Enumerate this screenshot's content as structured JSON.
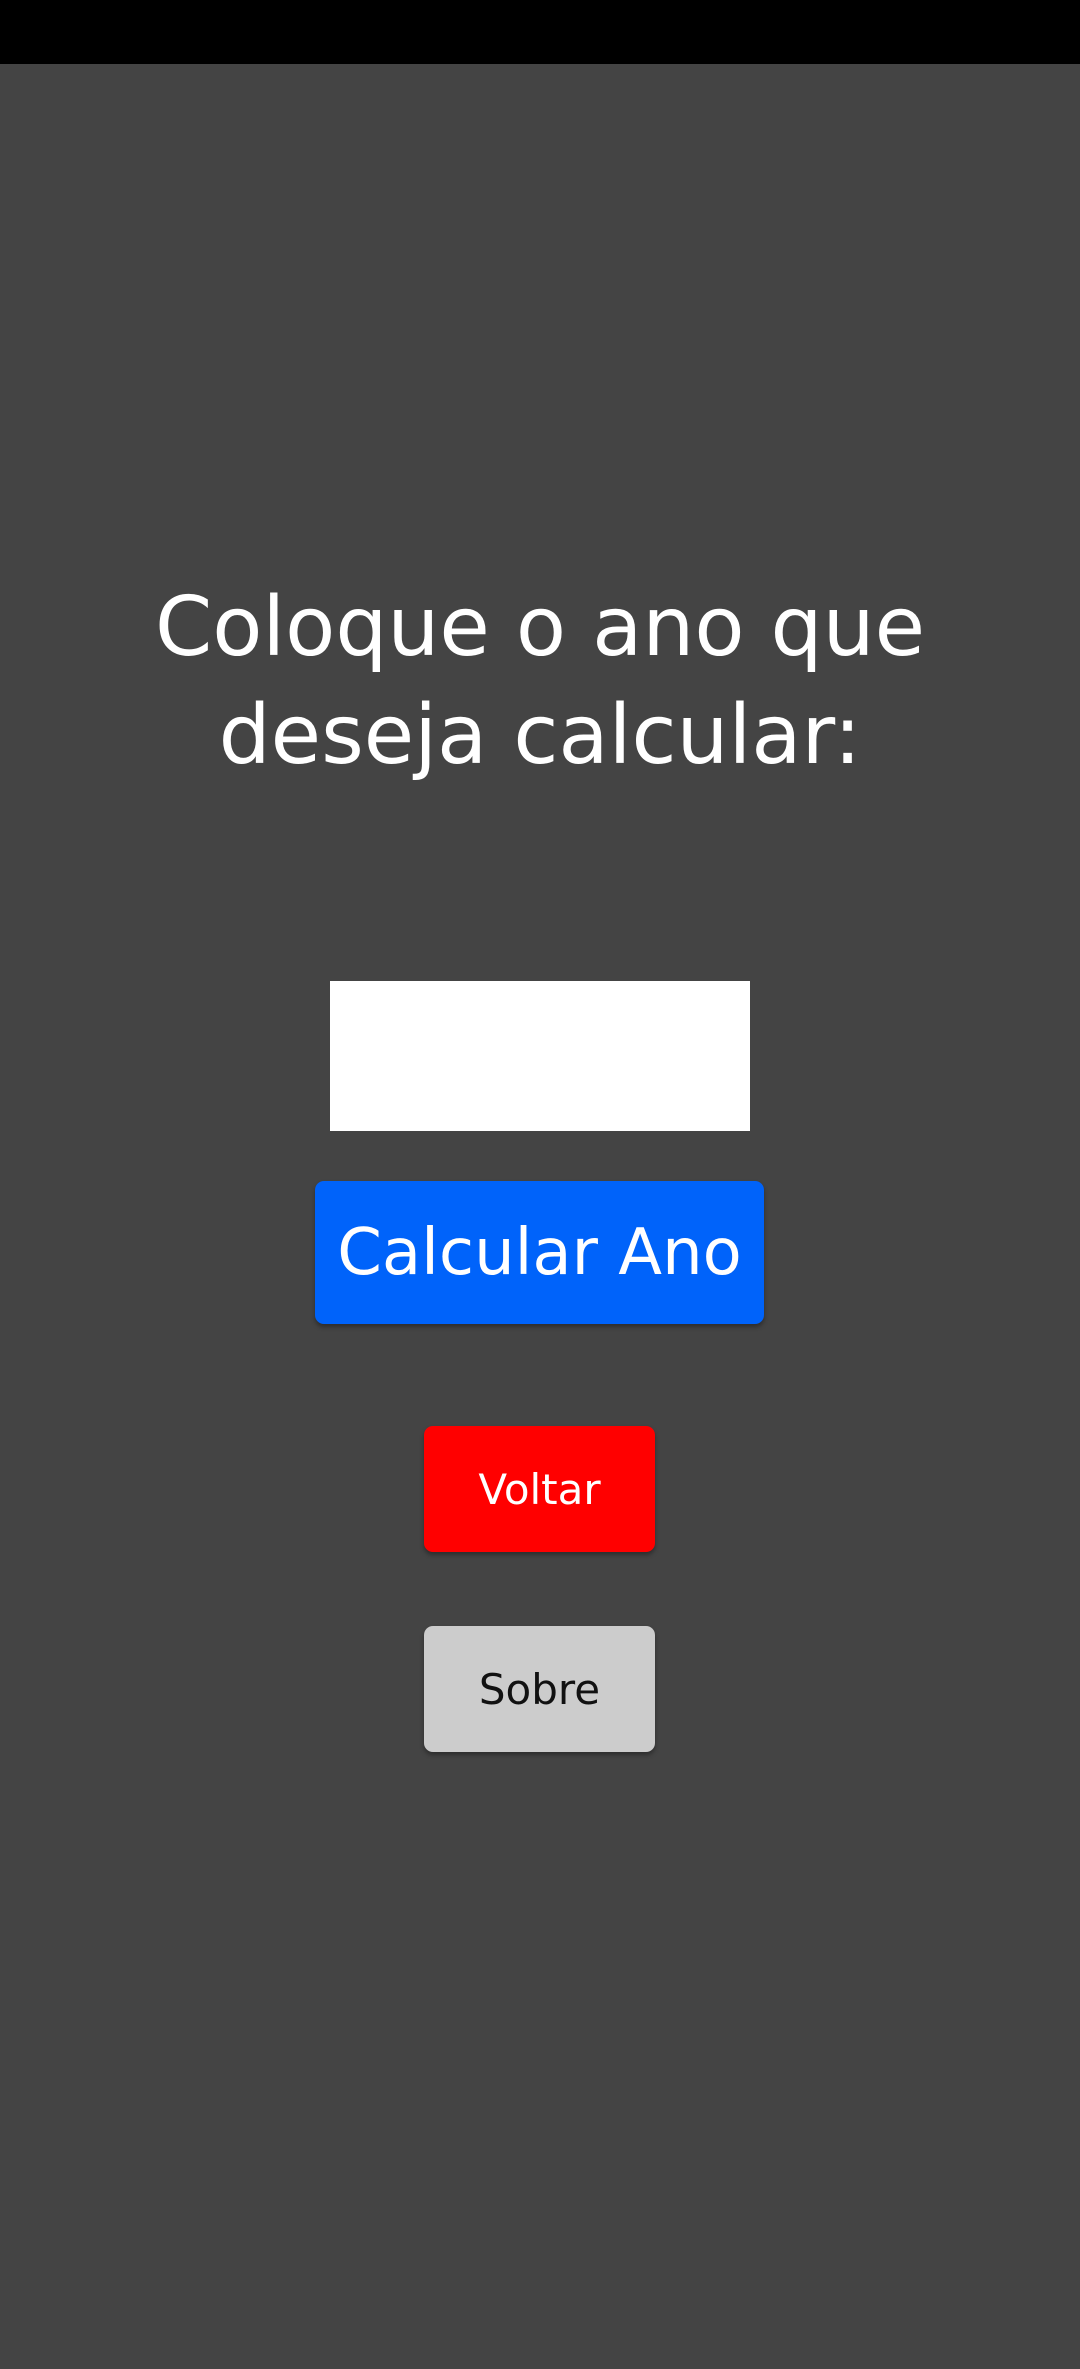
{
  "screen": {
    "prompt_line1": "Coloque o ano que",
    "prompt_line2": "deseja calcular:"
  },
  "year_input": {
    "value": "",
    "placeholder": ""
  },
  "buttons": {
    "calculate_label": "Calcular Ano",
    "back_label": "Voltar",
    "about_label": "Sobre"
  },
  "colors": {
    "background": "#444444",
    "status_bar": "#000000",
    "calculate": "#0063fa",
    "back": "#ff0000",
    "about": "#cccccc"
  }
}
